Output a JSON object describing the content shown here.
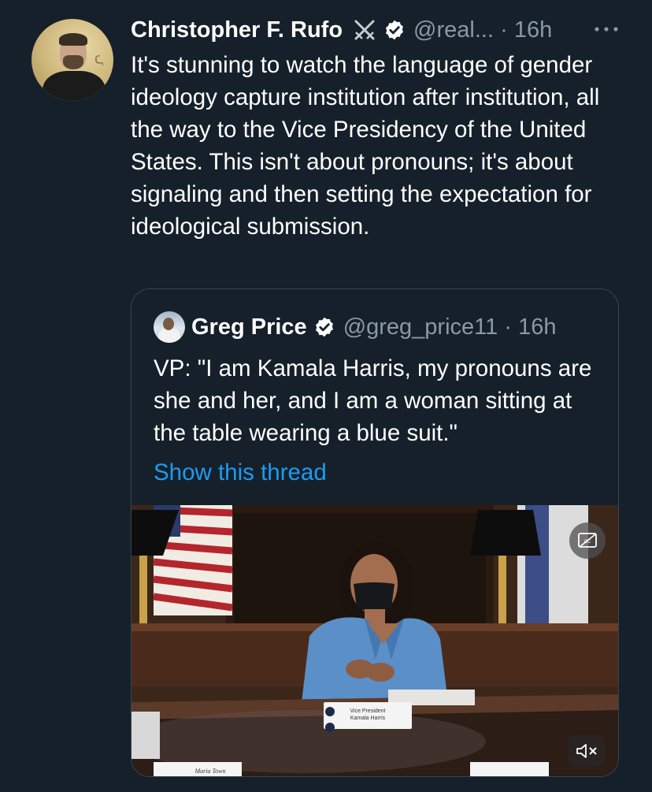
{
  "tweet": {
    "author_name": "Christopher F. Rufo",
    "author_handle": "@real...",
    "time_separator": "·",
    "time": "16h",
    "more_icon": "more-dots-icon",
    "text": "It's stunning to watch the language of gender ideology capture institution after institution, all the way to the Vice Presidency of the United States. This isn't about pronouns; it's about signaling and then setting the expectation for ideological submission."
  },
  "quote": {
    "author_name": "Greg Price",
    "author_handle": "@greg_price11",
    "time_separator": "·",
    "time": "16h",
    "text": "VP: \"I am Kamala Harris, my pronouns are she and her, and I am a woman sitting at the table wearing a blue suit.\"",
    "link_label": "Show this thread",
    "video": {
      "nameplate_top_line1": "Vice President",
      "nameplate_top_line2": "Kamala Harris",
      "nameplate_bottom": "Maria Town",
      "controls": [
        "captions-icon",
        "mute-icon"
      ]
    }
  },
  "colors": {
    "background": "#15202b",
    "secondary_text": "#8b98a5",
    "link": "#1d9bf0",
    "border": "#38444d",
    "suit_blue": "#5b8fc8"
  }
}
